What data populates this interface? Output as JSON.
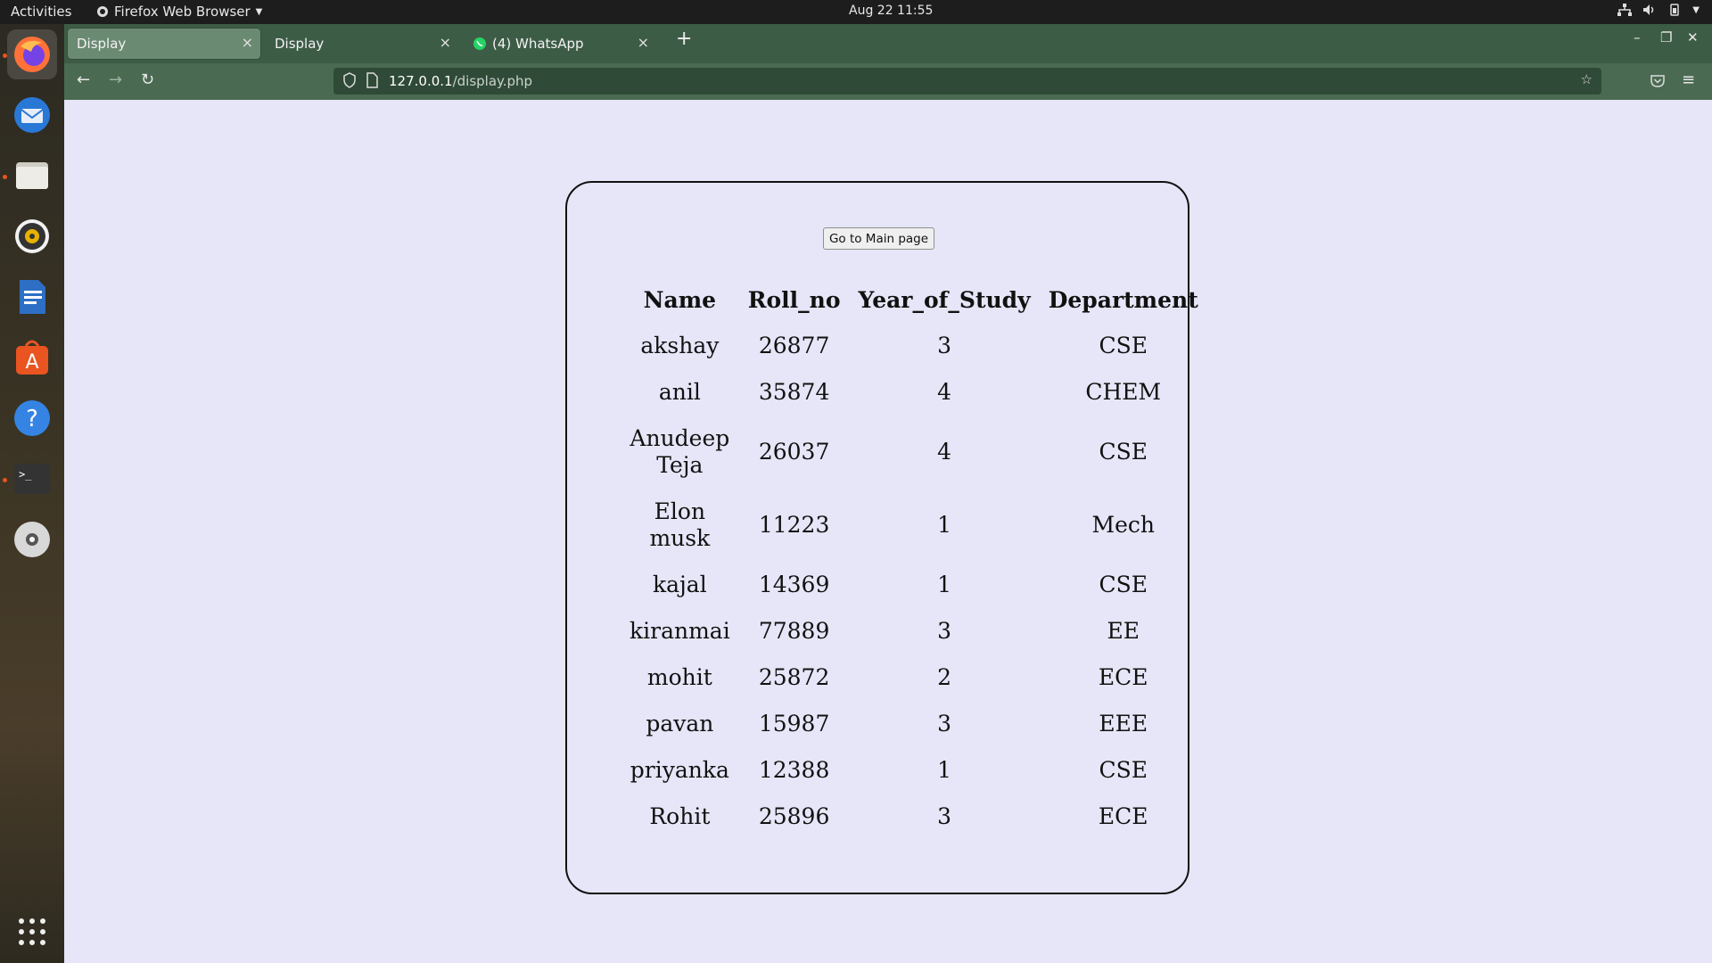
{
  "topbar": {
    "activities": "Activities",
    "app_name": "Firefox Web Browser",
    "clock": "Aug 22  11:55"
  },
  "dock": {
    "items": [
      {
        "name": "firefox-icon",
        "color": "#ff7139"
      },
      {
        "name": "thunderbird-icon",
        "color": "#2a78d6"
      },
      {
        "name": "files-icon",
        "color": "#d0cdc4"
      },
      {
        "name": "rhythmbox-icon",
        "color": "#e8b100"
      },
      {
        "name": "libreoffice-writer-icon",
        "color": "#2d6fc4"
      },
      {
        "name": "app-center-icon",
        "color": "#e95420"
      },
      {
        "name": "help-icon",
        "color": "#3584e4"
      },
      {
        "name": "terminal-icon",
        "color": "#333333"
      },
      {
        "name": "disc-icon",
        "color": "#cccccc"
      }
    ]
  },
  "browser": {
    "tabs": [
      {
        "label": "Display",
        "active": true
      },
      {
        "label": "Display",
        "active": false
      },
      {
        "label": "(4) WhatsApp",
        "active": false
      }
    ],
    "url_host": "127.0.0.1",
    "url_path": "/display.php"
  },
  "page": {
    "main_button": "Go to Main page",
    "headers": [
      "Name",
      "Roll_no",
      "Year_of_Study",
      "Department"
    ],
    "rows": [
      [
        "akshay",
        "26877",
        "3",
        "CSE"
      ],
      [
        "anil",
        "35874",
        "4",
        "CHEM"
      ],
      [
        "Anudeep Teja",
        "26037",
        "4",
        "CSE"
      ],
      [
        "Elon musk",
        "11223",
        "1",
        "Mech"
      ],
      [
        "kajal",
        "14369",
        "1",
        "CSE"
      ],
      [
        "kiranmai",
        "77889",
        "3",
        "EE"
      ],
      [
        "mohit",
        "25872",
        "2",
        "ECE"
      ],
      [
        "pavan",
        "15987",
        "3",
        "EEE"
      ],
      [
        "priyanka",
        "12388",
        "1",
        "CSE"
      ],
      [
        "Rohit",
        "25896",
        "3",
        "ECE"
      ]
    ]
  }
}
